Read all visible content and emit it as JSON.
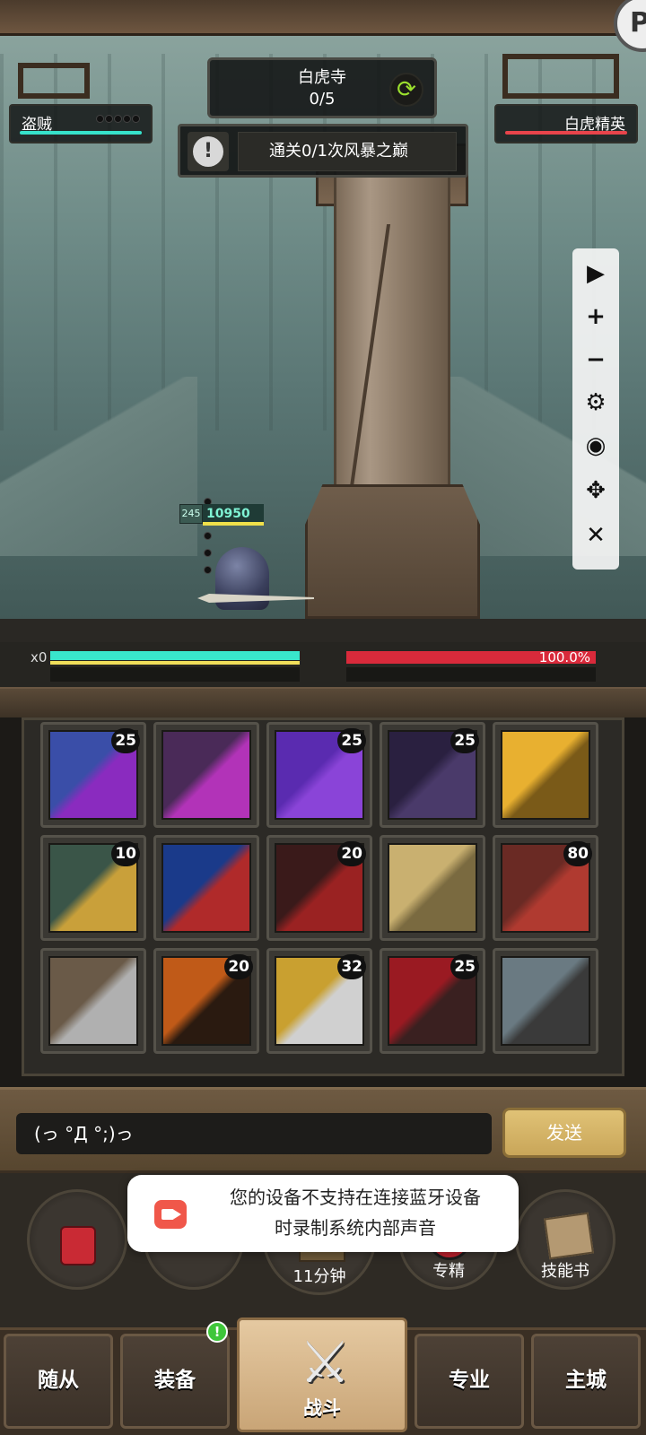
{
  "stage": {
    "name": "白虎寺",
    "progress": "0/5"
  },
  "quest": {
    "text": "通关0/1次风暴之巅"
  },
  "player": {
    "name": "盗贼",
    "level": "245",
    "hp": "10950",
    "combo": "x0"
  },
  "enemy": {
    "name": "白虎精英",
    "hp_percent": "100.0%"
  },
  "toolbar": {
    "icons": [
      "play-icon",
      "plus-icon",
      "minus-icon",
      "gear-icon",
      "eye-icon",
      "move-icon",
      "close-icon"
    ]
  },
  "skills": [
    {
      "name": "skill-shadow-mask",
      "count": "25",
      "colors": [
        "#3a4ea8",
        "#8a2bbf"
      ]
    },
    {
      "name": "skill-pink-demon",
      "count": "",
      "colors": [
        "#4a2a58",
        "#b233b8"
      ]
    },
    {
      "name": "skill-violet-blade",
      "count": "25",
      "colors": [
        "#5a2bb0",
        "#8a44d8"
      ]
    },
    {
      "name": "skill-dark-claws",
      "count": "25",
      "colors": [
        "#2a2040",
        "#4a3a6a"
      ]
    },
    {
      "name": "skill-golden-vortex",
      "count": "",
      "colors": [
        "#e8b030",
        "#7a5a18"
      ]
    },
    {
      "name": "skill-hooded-rogue",
      "count": "10",
      "colors": [
        "#3a5548",
        "#c9a03a"
      ]
    },
    {
      "name": "skill-serpent-orb",
      "count": "",
      "colors": [
        "#1a3a8a",
        "#b02a2a"
      ]
    },
    {
      "name": "skill-crimson-fist",
      "count": "20",
      "colors": [
        "#3a1a1a",
        "#9a2222"
      ]
    },
    {
      "name": "skill-grinning-face",
      "count": "",
      "colors": [
        "#c9b070",
        "#7a6a40"
      ]
    },
    {
      "name": "skill-loot-sack",
      "count": "80",
      "colors": [
        "#6a2a24",
        "#b03a30"
      ]
    },
    {
      "name": "skill-smoke-dagger",
      "count": "",
      "colors": [
        "#6a5a48",
        "#b0b0b0"
      ]
    },
    {
      "name": "skill-flame-blade",
      "count": "20",
      "colors": [
        "#c05a18",
        "#2a1a10"
      ]
    },
    {
      "name": "skill-golden-blade",
      "count": "32",
      "colors": [
        "#c9a030",
        "#d0d0d0"
      ]
    },
    {
      "name": "skill-blood-slash",
      "count": "25",
      "colors": [
        "#9a1a22",
        "#3a2020"
      ]
    },
    {
      "name": "skill-stone-beast",
      "count": "",
      "colors": [
        "#6a7a82",
        "#3a3a3a"
      ]
    }
  ],
  "chat": {
    "input_value": "(っ °Д °;)っ",
    "send_label": "发送"
  },
  "round_buttons": {
    "timer_label": "11分钟",
    "specialty_label": "专精",
    "skillbook_label": "技能书"
  },
  "toast": {
    "line1": "您的设备不支持在连接蓝牙设备",
    "line2": "时录制系统内部声音"
  },
  "nav": {
    "followers": "随从",
    "equipment": "装备",
    "battle": "战斗",
    "profession": "专业",
    "main_city": "主城",
    "equipment_badge": "!"
  }
}
